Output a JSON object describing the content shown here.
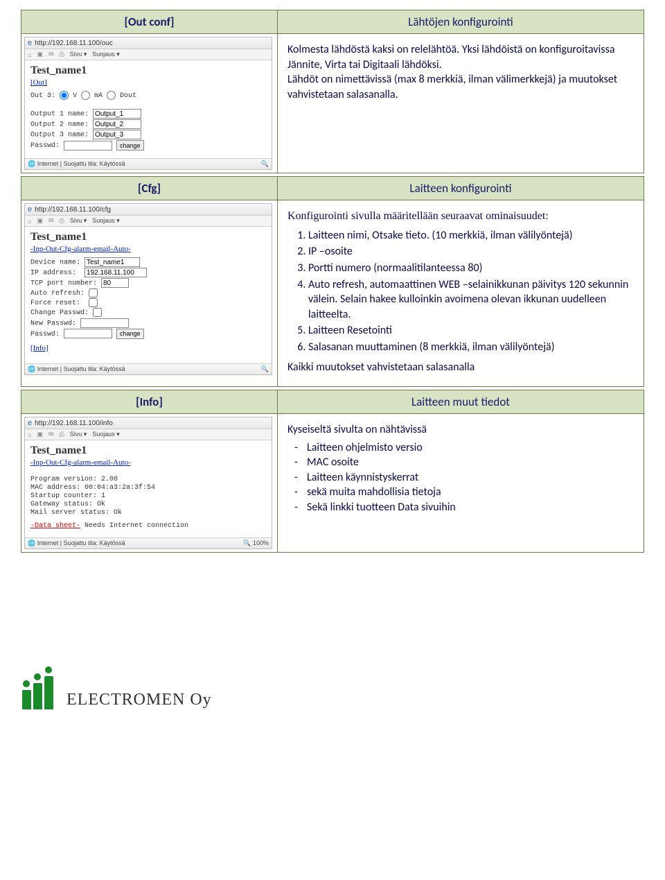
{
  "sections": {
    "out": {
      "label": "[Out conf]",
      "title": "Lähtöjen konfigurointi",
      "body": "Kolmesta lähdöstä kaksi on relelähtöä. Yksi lähdöistä on konfiguroitavissa Jännite, Virta tai Digitaali lähdöksi.\nLähdöt on nimettävissä (max 8 merkkiä, ilman välimerkkejä) ja muutokset vahvistetaan salasanalla.",
      "shot": {
        "url": "http://192.168.11.100/ouc",
        "iconrow": [
          "Sivu ▾",
          "Suojaus ▾"
        ],
        "title": "Test_name1",
        "link": "[Out]",
        "lines": [
          "Out 3: ● V ○ mA ○ Dout",
          "",
          "Output 1 name: [Output_1]",
          "Output 2 name: [Output_2]",
          "Output 3 name: [Output_3]",
          "Passwd: []  (change)"
        ],
        "out1": "Output_1",
        "out2": "Output_2",
        "out3": "Output_3",
        "change_btn": "change",
        "status": "Internet | Suojattu tila: Käytössä"
      }
    },
    "cfg": {
      "label": "[Cfg]",
      "title": "Laitteen konfigurointi",
      "intro": "Konfigurointi sivulla määritellään seuraavat ominaisuudet:",
      "items": [
        "Laitteen nimi, Otsake tieto. (10 merkkiä, ilman välilyöntejä)",
        "IP –osoite",
        "Portti numero (normaalitilanteessa 80)",
        "Auto refresh, automaattinen WEB –selainikkunan päivitys 120 sekunnin välein. Selain hakee kulloinkin avoimena olevan ikkunan uudelleen laitteelta.",
        "Laitteen Resetointi",
        "Salasanan muuttaminen (8 merkkiä, ilman välilyöntejä)"
      ],
      "footer": "Kaikki muutokset vahvistetaan salasanalla",
      "shot": {
        "url": "http://192.168.11.100/cfg",
        "iconrow": [
          "Sivu ▾",
          "Suojaus ▾"
        ],
        "title": "Test_name1",
        "link": "-Inp-Out-Cfg-alarm-email-Auto-",
        "dev_name": "Test_name1",
        "ip": "192.168.11.100",
        "port": "80",
        "change_btn": "change",
        "info_link": "[Info]",
        "status": "Internet | Suojattu tila: Käytössä"
      }
    },
    "info": {
      "label": "[Info]",
      "title": "Laitteen muut tiedot",
      "intro": "Kyseiseltä sivulta on nähtävissä",
      "items": [
        "Laitteen ohjelmisto versio",
        "MAC osoite",
        "Laitteen käynnistyskerrat",
        "sekä muita mahdollisia tietoja",
        "Sekä linkki tuotteen Data sivuihin"
      ],
      "shot": {
        "url": "http://192.168.11.100/info",
        "iconrow": [
          "Sivu ▾",
          "Suojaus ▾"
        ],
        "title": "Test_name1",
        "link": "-Inp-Out-Cfg-alarm-email-Auto-",
        "prog_ver": "Program version: 2.00",
        "mac": "MAC address: 00:04:a3:2a:3f:54",
        "startup": "Startup counter: 1",
        "gw": "Gateway status: Ok",
        "mail": "Mail server status: Ok",
        "ds": "-Data sheet- Needs Internet connection",
        "status": "Internet | Suojattu tila: Käytössä",
        "zoom": "100%"
      }
    }
  },
  "footer": {
    "company": "ELECTROMEN Oy"
  }
}
